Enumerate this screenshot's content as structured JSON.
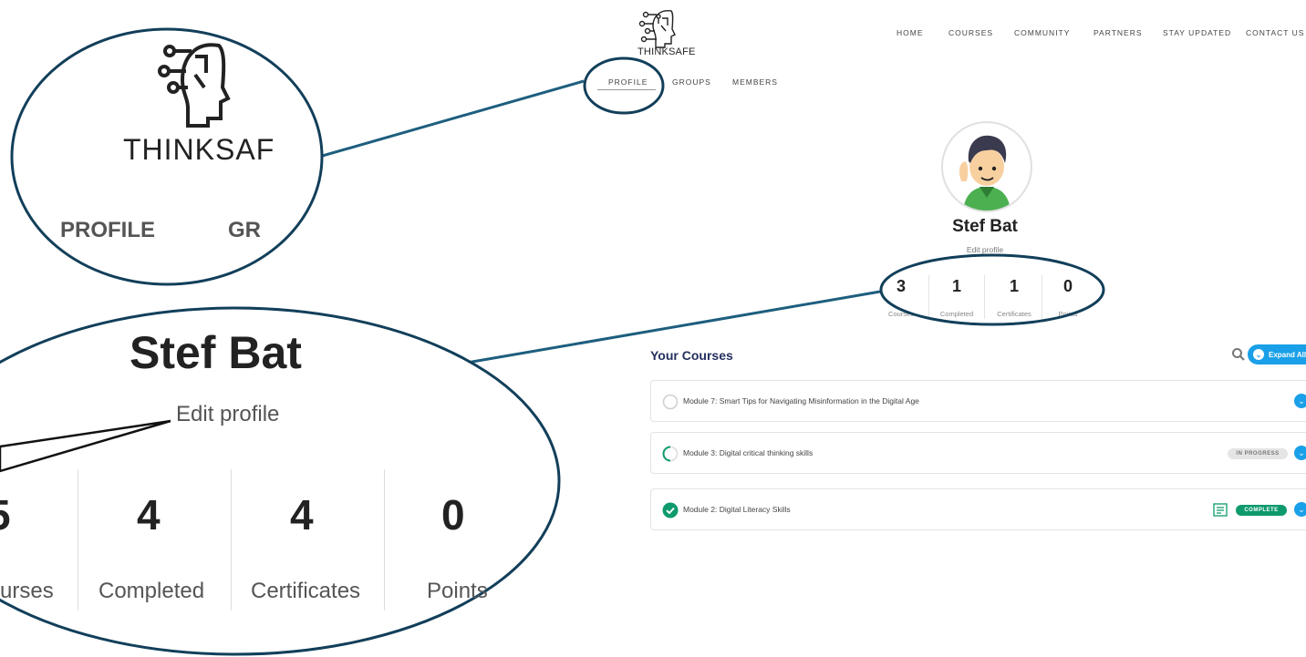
{
  "header": {
    "logo_text": "THINKSAFE",
    "nav": [
      "HOME",
      "COURSES",
      "COMMUNITY",
      "PARTNERS",
      "STAY UPDATED",
      "CONTACT US"
    ]
  },
  "subnav": [
    "PROFILE",
    "GROUPS",
    "MEMBERS"
  ],
  "profile": {
    "name": "Stef Bat",
    "edit_link": "Edit profile",
    "stats": [
      {
        "value": "3",
        "label": "Courses"
      },
      {
        "value": "1",
        "label": "Completed"
      },
      {
        "value": "1",
        "label": "Certificates"
      },
      {
        "value": "0",
        "label": "Points"
      }
    ]
  },
  "courses": {
    "heading": "Your Courses",
    "expand_label": "Expand All",
    "items": [
      {
        "title": "Module 7: Smart Tips for Navigating Misinformation in the Digital Age",
        "status": "not-started",
        "badge": ""
      },
      {
        "title": "Module 3: Digital critical thinking skills",
        "status": "in-progress",
        "badge": "IN PROGRESS"
      },
      {
        "title": "Module 2: Digital Literacy Skills",
        "status": "complete",
        "badge": "COMPLETE"
      }
    ]
  },
  "zoom": {
    "logo_text": "THINKSAF",
    "profile": "PROFILE",
    "groups_partial": "GR",
    "name": "Stef Bat",
    "edit_link": "Edit profile",
    "stats": [
      {
        "value": "5",
        "label": "urses"
      },
      {
        "value": "4",
        "label": "Completed"
      },
      {
        "value": "4",
        "label": "Certificates"
      },
      {
        "value": "0",
        "label": "Points"
      }
    ]
  },
  "colors": {
    "accent": "#1aa0e8",
    "heading": "#24305e",
    "complete": "#0f9a6e",
    "annotation": "#123f5a"
  }
}
